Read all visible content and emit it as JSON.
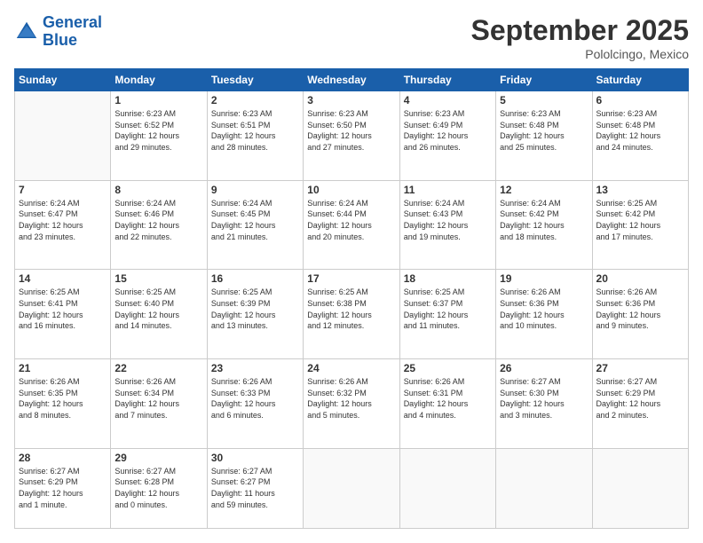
{
  "header": {
    "logo_line1": "General",
    "logo_line2": "Blue",
    "month": "September 2025",
    "location": "Pololcingo, Mexico"
  },
  "weekdays": [
    "Sunday",
    "Monday",
    "Tuesday",
    "Wednesday",
    "Thursday",
    "Friday",
    "Saturday"
  ],
  "weeks": [
    [
      {
        "day": "",
        "info": ""
      },
      {
        "day": "1",
        "info": "Sunrise: 6:23 AM\nSunset: 6:52 PM\nDaylight: 12 hours\nand 29 minutes."
      },
      {
        "day": "2",
        "info": "Sunrise: 6:23 AM\nSunset: 6:51 PM\nDaylight: 12 hours\nand 28 minutes."
      },
      {
        "day": "3",
        "info": "Sunrise: 6:23 AM\nSunset: 6:50 PM\nDaylight: 12 hours\nand 27 minutes."
      },
      {
        "day": "4",
        "info": "Sunrise: 6:23 AM\nSunset: 6:49 PM\nDaylight: 12 hours\nand 26 minutes."
      },
      {
        "day": "5",
        "info": "Sunrise: 6:23 AM\nSunset: 6:48 PM\nDaylight: 12 hours\nand 25 minutes."
      },
      {
        "day": "6",
        "info": "Sunrise: 6:23 AM\nSunset: 6:48 PM\nDaylight: 12 hours\nand 24 minutes."
      }
    ],
    [
      {
        "day": "7",
        "info": "Sunrise: 6:24 AM\nSunset: 6:47 PM\nDaylight: 12 hours\nand 23 minutes."
      },
      {
        "day": "8",
        "info": "Sunrise: 6:24 AM\nSunset: 6:46 PM\nDaylight: 12 hours\nand 22 minutes."
      },
      {
        "day": "9",
        "info": "Sunrise: 6:24 AM\nSunset: 6:45 PM\nDaylight: 12 hours\nand 21 minutes."
      },
      {
        "day": "10",
        "info": "Sunrise: 6:24 AM\nSunset: 6:44 PM\nDaylight: 12 hours\nand 20 minutes."
      },
      {
        "day": "11",
        "info": "Sunrise: 6:24 AM\nSunset: 6:43 PM\nDaylight: 12 hours\nand 19 minutes."
      },
      {
        "day": "12",
        "info": "Sunrise: 6:24 AM\nSunset: 6:42 PM\nDaylight: 12 hours\nand 18 minutes."
      },
      {
        "day": "13",
        "info": "Sunrise: 6:25 AM\nSunset: 6:42 PM\nDaylight: 12 hours\nand 17 minutes."
      }
    ],
    [
      {
        "day": "14",
        "info": "Sunrise: 6:25 AM\nSunset: 6:41 PM\nDaylight: 12 hours\nand 16 minutes."
      },
      {
        "day": "15",
        "info": "Sunrise: 6:25 AM\nSunset: 6:40 PM\nDaylight: 12 hours\nand 14 minutes."
      },
      {
        "day": "16",
        "info": "Sunrise: 6:25 AM\nSunset: 6:39 PM\nDaylight: 12 hours\nand 13 minutes."
      },
      {
        "day": "17",
        "info": "Sunrise: 6:25 AM\nSunset: 6:38 PM\nDaylight: 12 hours\nand 12 minutes."
      },
      {
        "day": "18",
        "info": "Sunrise: 6:25 AM\nSunset: 6:37 PM\nDaylight: 12 hours\nand 11 minutes."
      },
      {
        "day": "19",
        "info": "Sunrise: 6:26 AM\nSunset: 6:36 PM\nDaylight: 12 hours\nand 10 minutes."
      },
      {
        "day": "20",
        "info": "Sunrise: 6:26 AM\nSunset: 6:36 PM\nDaylight: 12 hours\nand 9 minutes."
      }
    ],
    [
      {
        "day": "21",
        "info": "Sunrise: 6:26 AM\nSunset: 6:35 PM\nDaylight: 12 hours\nand 8 minutes."
      },
      {
        "day": "22",
        "info": "Sunrise: 6:26 AM\nSunset: 6:34 PM\nDaylight: 12 hours\nand 7 minutes."
      },
      {
        "day": "23",
        "info": "Sunrise: 6:26 AM\nSunset: 6:33 PM\nDaylight: 12 hours\nand 6 minutes."
      },
      {
        "day": "24",
        "info": "Sunrise: 6:26 AM\nSunset: 6:32 PM\nDaylight: 12 hours\nand 5 minutes."
      },
      {
        "day": "25",
        "info": "Sunrise: 6:26 AM\nSunset: 6:31 PM\nDaylight: 12 hours\nand 4 minutes."
      },
      {
        "day": "26",
        "info": "Sunrise: 6:27 AM\nSunset: 6:30 PM\nDaylight: 12 hours\nand 3 minutes."
      },
      {
        "day": "27",
        "info": "Sunrise: 6:27 AM\nSunset: 6:29 PM\nDaylight: 12 hours\nand 2 minutes."
      }
    ],
    [
      {
        "day": "28",
        "info": "Sunrise: 6:27 AM\nSunset: 6:29 PM\nDaylight: 12 hours\nand 1 minute."
      },
      {
        "day": "29",
        "info": "Sunrise: 6:27 AM\nSunset: 6:28 PM\nDaylight: 12 hours\nand 0 minutes."
      },
      {
        "day": "30",
        "info": "Sunrise: 6:27 AM\nSunset: 6:27 PM\nDaylight: 11 hours\nand 59 minutes."
      },
      {
        "day": "",
        "info": ""
      },
      {
        "day": "",
        "info": ""
      },
      {
        "day": "",
        "info": ""
      },
      {
        "day": "",
        "info": ""
      }
    ]
  ]
}
